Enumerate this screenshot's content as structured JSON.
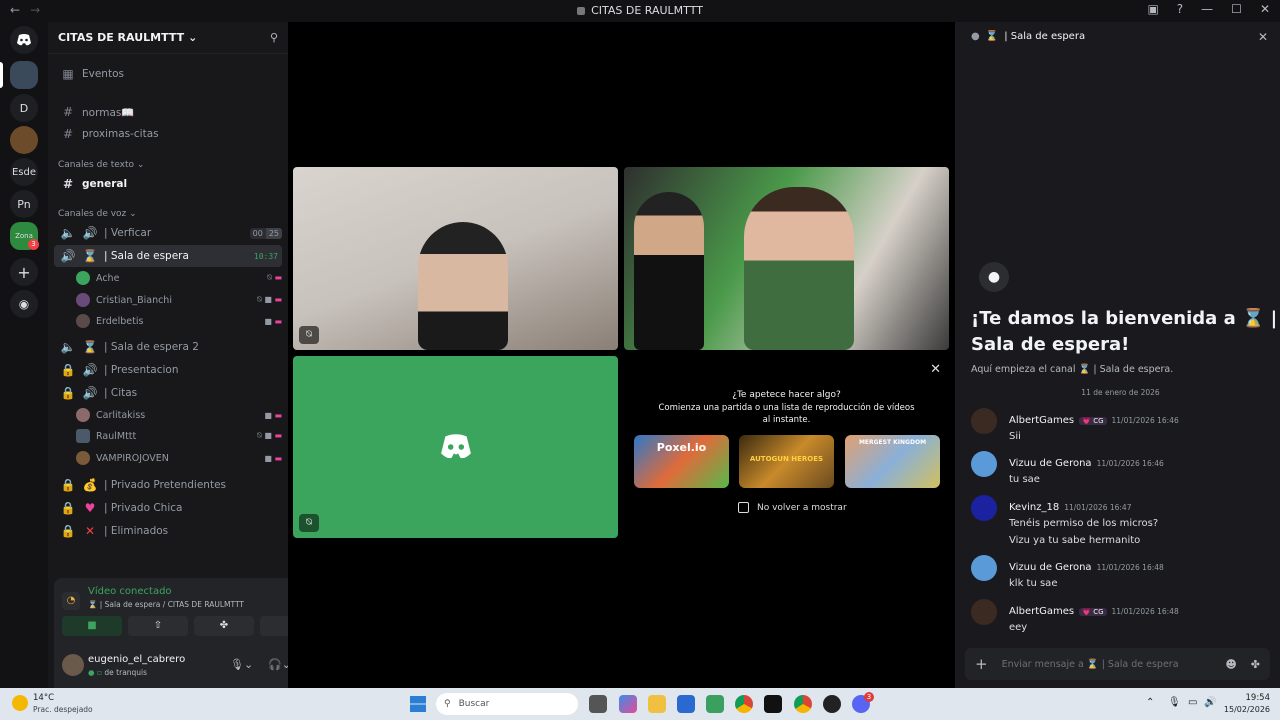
{
  "window": {
    "title": "CITAS DE RAULMTTT",
    "back": "←",
    "forward": "→"
  },
  "servers": [
    {
      "label": "D"
    },
    {
      "label": "Esde"
    },
    {
      "label": "Pn"
    },
    {
      "label": "Zona",
      "badge": "3"
    }
  ],
  "guild": {
    "name": "CITAS DE RAULMTTT"
  },
  "channels": {
    "events": "Eventos",
    "normas": "normas📖",
    "proximas": "proximas-citas",
    "text_category": "Canales de texto",
    "general": "general",
    "voice_category": "Canales de voz",
    "verificar": "| Verficar",
    "verificar_count_a": "00",
    "verificar_count_b": "25",
    "sala": "| Sala de espera",
    "sala_time": "10:37",
    "sala2": "| Sala de espera 2",
    "presentacion": "| Presentacion",
    "citas": "| Citas",
    "privado_pret": "| Privado Pretendientes",
    "privado_chica": "| Privado Chica",
    "eliminados": "| Eliminados"
  },
  "sala_users": [
    "Ache",
    "Cristian_Bianchi",
    "Erdelbetis"
  ],
  "citas_users": [
    "Carlitakiss",
    "RaulMttt",
    "VAMPIROJOVEN"
  ],
  "voice_panel": {
    "status": "Vídeo conectado",
    "location": "| Sala de espera / CITAS DE RAULMTTT",
    "username": "eugenio_el_cabrero",
    "user_status": "de tranquis"
  },
  "activity": {
    "question": "¿Te apetece hacer algo?",
    "desc": "Comienza una partida o una lista de reproducción de vídeos al instante.",
    "games": [
      "Poxel.io",
      "AUTOGUN HEROES",
      "MERGEST KINGDOM"
    ],
    "checkbox": "No volver a mostrar"
  },
  "chat": {
    "header": "| Sala de espera",
    "welcome_a": "¡Te damos la bienvenida a ⌛ |",
    "welcome_b": "Sala de espera!",
    "sub": "Aquí empieza el canal ⌛ | Sala de espera.",
    "date": "11 de enero de 2026",
    "input_placeholder": "Enviar mensaje a ⌛ | Sala de espera",
    "messages": [
      {
        "name": "AlbertGames",
        "tag": "CG",
        "time": "11/01/2026 16:46",
        "lines": [
          "Sii"
        ]
      },
      {
        "name": "Vizuu de Gerona",
        "time": "11/01/2026 16:46",
        "lines": [
          "tu sae"
        ]
      },
      {
        "name": "Kevinz_18",
        "time": "11/01/2026 16:47",
        "lines": [
          "Tenéis permiso de los micros?",
          "Vizu ya tu sabe hermanito"
        ]
      },
      {
        "name": "Vizuu de Gerona",
        "time": "11/01/2026 16:48",
        "lines": [
          "klk tu sae"
        ]
      },
      {
        "name": "AlbertGames",
        "tag": "CG",
        "time": "11/01/2026 16:48",
        "lines": [
          "eey"
        ]
      }
    ]
  },
  "taskbar": {
    "temp": "14°C",
    "weather": "Prac. despejado",
    "search": "Buscar",
    "time": "19:54",
    "date": "15/02/2026",
    "discord_badge": "3"
  },
  "colors": {
    "green": "#3ba55d",
    "blurple": "#5865f2",
    "accent_pink": "#eb459e"
  }
}
